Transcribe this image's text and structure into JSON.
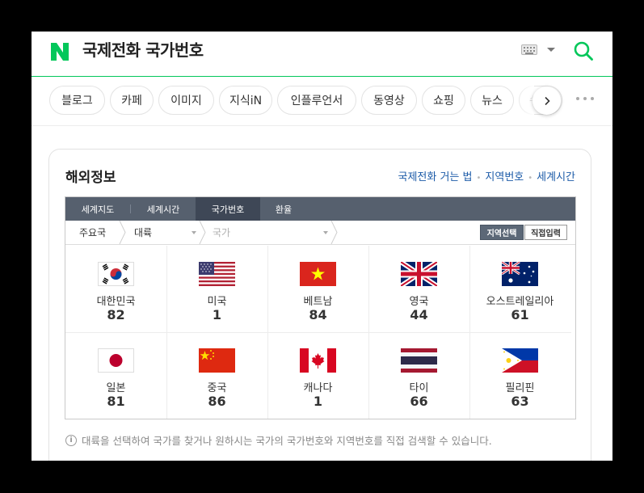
{
  "header": {
    "title": "국제전화 국가번호",
    "logo_letter": "N",
    "brand_color": "#03c75a",
    "icons": [
      "keyboard-icon",
      "search-icon"
    ]
  },
  "tabs": [
    "블로그",
    "카페",
    "이미지",
    "지식iN",
    "인플루언서",
    "동영상",
    "쇼핑",
    "뉴스",
    "쉬"
  ],
  "card": {
    "title": "해외정보",
    "links": [
      "국제전화 거는 법",
      "지역번호",
      "세계시간"
    ]
  },
  "panel": {
    "nav_tabs": [
      "세계지도",
      "세계시간",
      "국가번호",
      "환율"
    ],
    "active_tab": "국가번호",
    "breadcrumb": {
      "main": "주요국",
      "continent": "대륙",
      "country": "국가"
    },
    "buttons": {
      "region_select": "지역선택",
      "direct_input": "직접입력"
    },
    "countries": [
      {
        "name": "대한민국",
        "code": "82",
        "flag": "kr"
      },
      {
        "name": "미국",
        "code": "1",
        "flag": "us"
      },
      {
        "name": "베트남",
        "code": "84",
        "flag": "vn"
      },
      {
        "name": "영국",
        "code": "44",
        "flag": "gb"
      },
      {
        "name": "오스트레일리아",
        "code": "61",
        "flag": "au"
      },
      {
        "name": "일본",
        "code": "81",
        "flag": "jp"
      },
      {
        "name": "중국",
        "code": "86",
        "flag": "cn"
      },
      {
        "name": "캐나다",
        "code": "1",
        "flag": "ca"
      },
      {
        "name": "타이",
        "code": "66",
        "flag": "th"
      },
      {
        "name": "필리핀",
        "code": "63",
        "flag": "ph"
      }
    ]
  },
  "note": "대륙을 선택하여 국가를 찾거나 원하시는 국가의 국가번호와 지역번호를 직접 검색할 수 있습니다."
}
